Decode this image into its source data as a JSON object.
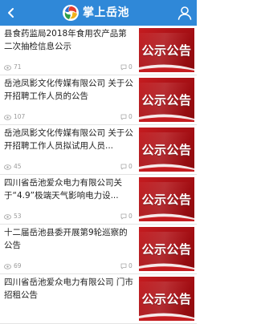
{
  "header": {
    "title": "掌上岳池",
    "back_icon": "chevron-left-icon",
    "user_icon": "user-icon",
    "color": "#2f88d8"
  },
  "news": [
    {
      "title": "县食药监局2018年食用农产品第二次抽检信息公示",
      "views": "71",
      "comments": "0",
      "thumb_text": "公示公告"
    },
    {
      "title": "岳池凤影文化传媒有限公司 关于公开招聘工作人员的公告",
      "views": "107",
      "comments": "0",
      "thumb_text": "公示公告"
    },
    {
      "title": "岳池凤影文化传媒有限公司 关于公开招聘工作人员拟试用人员...",
      "views": "45",
      "comments": "0",
      "thumb_text": "公示公告"
    },
    {
      "title": "四川省岳池爱众电力有限公司关于“4.9”极端天气影响电力设...",
      "views": "53",
      "comments": "0",
      "thumb_text": "公示公告"
    },
    {
      "title": "十二届岳池县委开展第9轮巡察的公告",
      "views": "69",
      "comments": "0",
      "thumb_text": "公示公告"
    },
    {
      "title": "四川省岳池爱众电力有限公司 门市招租公告",
      "views": "",
      "comments": "",
      "thumb_text": "公示公告"
    }
  ],
  "colors": {
    "thumb": "#b8161a",
    "meta": "#9a9a9a"
  }
}
